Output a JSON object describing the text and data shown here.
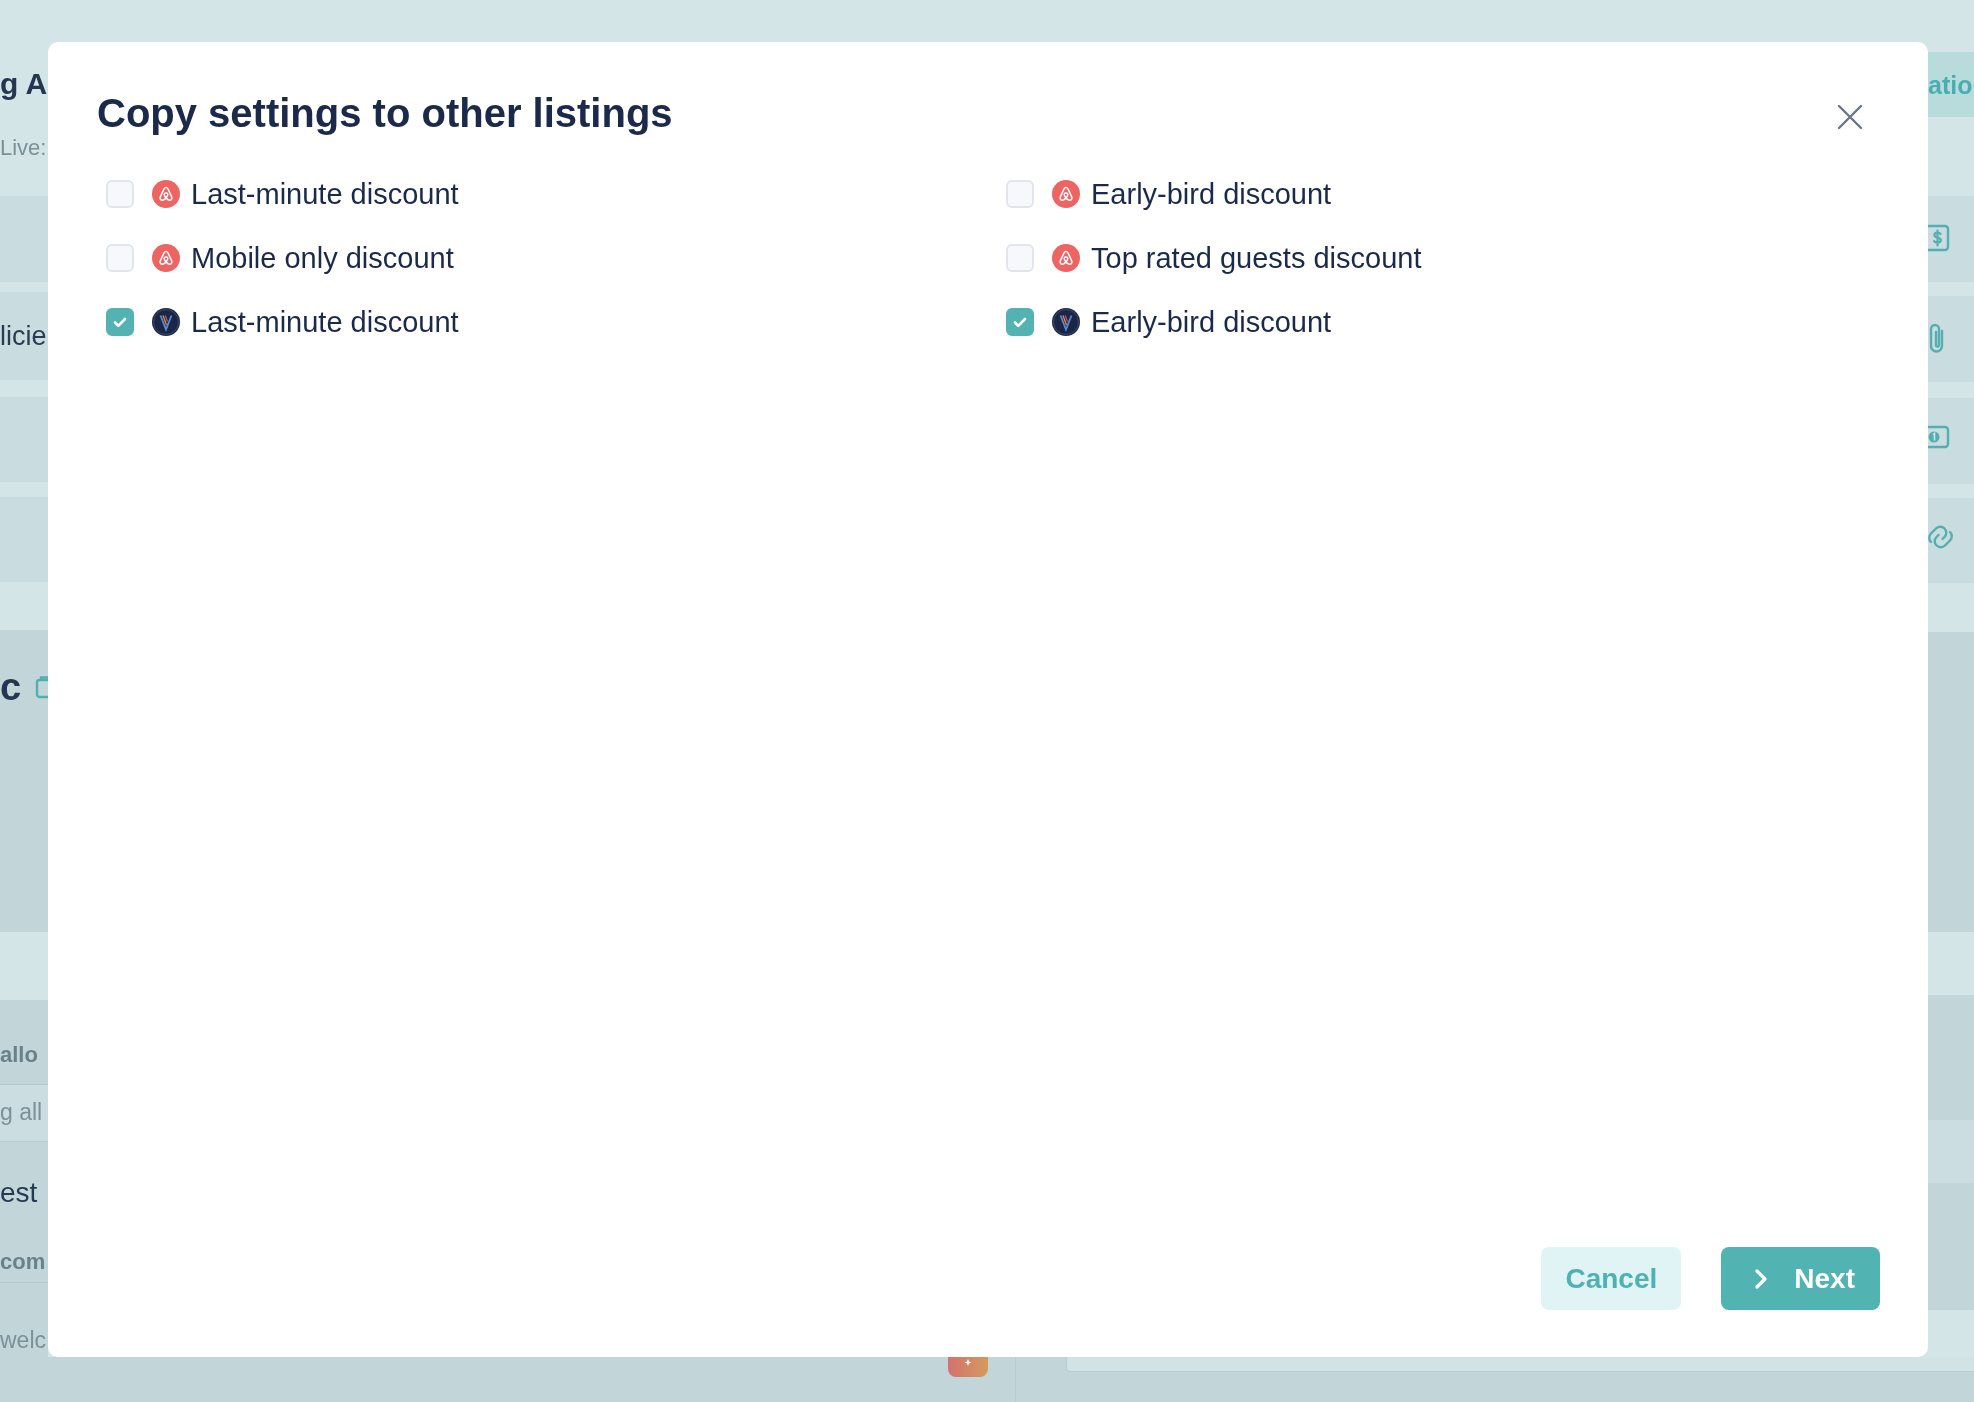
{
  "background_page": {
    "title": "g A",
    "subtitle": "Live:",
    "menu_item": "licie",
    "section_heading": "c",
    "rows": [
      {
        "kind": "label",
        "text": "allo"
      },
      {
        "kind": "value",
        "text": "g all"
      },
      {
        "kind": "text",
        "text": "est"
      },
      {
        "kind": "label",
        "text": "com"
      },
      {
        "kind": "value",
        "text": "welc"
      }
    ],
    "side_tab": "atio"
  },
  "dialog": {
    "title": "Copy settings to other listings",
    "options": [
      {
        "kind": "coral",
        "label": "Last-minute discount",
        "checked": false
      },
      {
        "kind": "coral",
        "label": "Early-bird discount",
        "checked": false
      },
      {
        "kind": "coral",
        "label": "Mobile only discount",
        "checked": false
      },
      {
        "kind": "coral",
        "label": "Top rated guests discount",
        "checked": false
      },
      {
        "kind": "navy",
        "label": "Last-minute discount",
        "checked": true
      },
      {
        "kind": "navy",
        "label": "Early-bird discount",
        "checked": true
      }
    ],
    "buttons": [
      {
        "kind": "secondary",
        "label": "Cancel"
      },
      {
        "kind": "primary",
        "label": "Next"
      }
    ]
  }
}
